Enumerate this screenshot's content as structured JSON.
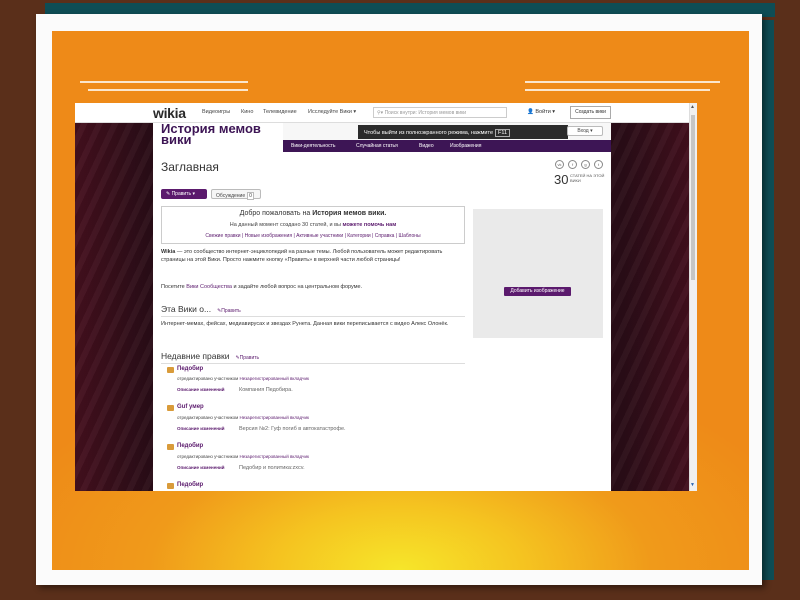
{
  "browser": {
    "logo": "wikia",
    "nav": [
      "Видеоигры",
      "Кино",
      "Телевидение",
      "Исследуйте Вики ▾"
    ],
    "search_placeholder": "Поиск внутри: История мемов вики",
    "login": "Войти ▾",
    "create_wiki": "Создать вики"
  },
  "wiki": {
    "title": "История мемов вики",
    "fullscreen_tip": "Чтобы выйти из полноэкранного режима, нажмите",
    "fullscreen_key": "F11",
    "enter_button": "Вход ▾",
    "nav": [
      "Вики-деятельность",
      "Случайная статья",
      "Видео",
      "Изображения"
    ]
  },
  "page": {
    "title": "Заглавная",
    "social": [
      "vk",
      "f",
      "g",
      "t"
    ],
    "articles_count": "30",
    "articles_label": "СТАТЕЙ НА ЭТОЙ ВИКИ",
    "edit_button": "✎ Править ▾",
    "discussion_button": "Обсуждение",
    "discussion_count": "0",
    "welcome": {
      "prefix": "Добро пожаловать на",
      "wiki_name": "История мемов вики.",
      "sub_prefix": "На данный момент создано 30 статей, и вы",
      "sub_link": "можете помочь нам",
      "links": "Свежие правки | Новые изображения | Активные участники | Категории | Справка | Шаблоны"
    },
    "intro_bold": "Wikia",
    "intro_text": " — это сообщество интернет-энциклопедий на разные темы. Любой пользователь может редактировать страницы на этой Вики. Просто нажмите кнопку «Править» в верхней части любой страницы!",
    "forum_prefix": "Посетите ",
    "forum_link": "Вики Сообщества",
    "forum_suffix": " и задайте любой вопрос на центральном форуме.",
    "about_title": "Эта Вики о...",
    "about_edit": "Править",
    "about_text": "Интернет-мемах, фейсах, медиавирусах и звездах Рунета. Данная вики переписывается с видео Алекс Олонёк.",
    "recent_title": "Недавние правки",
    "recent_edit": "Править",
    "add_image": "Добавить изображение",
    "recent": [
      {
        "title": "Педобир",
        "meta": "отредактировано участником",
        "user": "Незарегистрированный вкладчик",
        "desc_label": "Описание изменений",
        "desc": "Компания Педобира."
      },
      {
        "title": "Guf умер",
        "meta": "отредактировано участником",
        "user": "Незарегистрированный вкладчик",
        "desc_label": "Описание изменений",
        "desc": "Версия №2: Гуф погиб в автокатастрофе."
      },
      {
        "title": "Педобир",
        "meta": "отредактировано участником",
        "user": "Незарегистрированный вкладчик",
        "desc_label": "Описание изменений",
        "desc": "Педобир и политика:zxcv."
      },
      {
        "title": "Педобир"
      }
    ]
  },
  "colors": {
    "wiki_purple": "#5b1a6d",
    "slide_orange": "#ee8a18",
    "slide_yellow": "#f6e62a",
    "frame_teal": "#0e4d55"
  }
}
